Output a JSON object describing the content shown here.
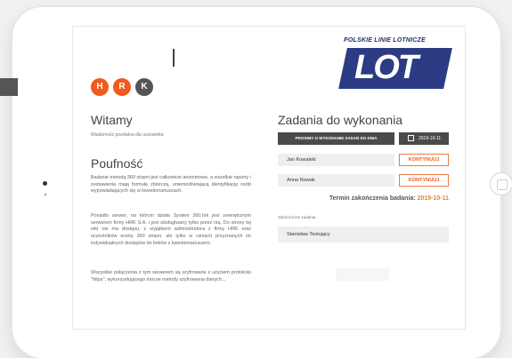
{
  "brand": {
    "hrk_letters": [
      "H",
      "R",
      "K"
    ],
    "hrk_colors": [
      "#ef5a1f",
      "#ef5a1f",
      "#555555"
    ],
    "airline_name": "POLSKIE LINIE LOTNICZE",
    "airline_logo_text": "LOT",
    "airline_color": "#2b3c85"
  },
  "left": {
    "welcome_title": "Witamy",
    "welcome_subtitle": "Wiadomość powitalna dla uczestnika",
    "privacy_title": "Poufność",
    "paragraph_1": "Badanie metodą 360 stopni jest całkowicie anonimowe, a wszelkie raporty i zestawienia mają formułę zbiorczą, uniemożliwiającą identyfikację osób wypowiadających się w kwestionariuszach.",
    "paragraph_2a": "Ponadto serwer, na którym działa ",
    "paragraph_2_italic": "System 360.hrk",
    "paragraph_2b": " jest zewnętrznym serwerem firmy HRK S.A. i jest obsługiwany tylko przez nią. Do strony tej nikt nie ma dostępu, z wyjątkiem administratora z firmy HRK oraz uczestników oceny 360 stopni, ale tylko w ramach przyznanych im indywidualnych dostępów do linków z kwestionariuszem.",
    "paragraph_3": "Wszystkie połączenia z tym serwerem są szyfrowane z użyciem protokołu \"https\", wykorzystującego mocne metody szyfrowania danych..."
  },
  "right": {
    "tasks_title": "Zadania do wykonania",
    "table_header": "PROSIMY O WYKONANIE ZADAŃ DO DNIA",
    "table_date": "2019-10-11",
    "rows": [
      {
        "name": "Jan Kowalski",
        "action": "KONTYNUUJ"
      },
      {
        "name": "Anna Nowak",
        "action": "KONTYNUUJ"
      }
    ],
    "deadline_prefix": "Termin zakończenia badania:",
    "deadline_date": "2019-10-11",
    "completed_label": "Zakończone zadania",
    "completed_rows": [
      {
        "name": "Stanisław Testujący"
      }
    ]
  }
}
